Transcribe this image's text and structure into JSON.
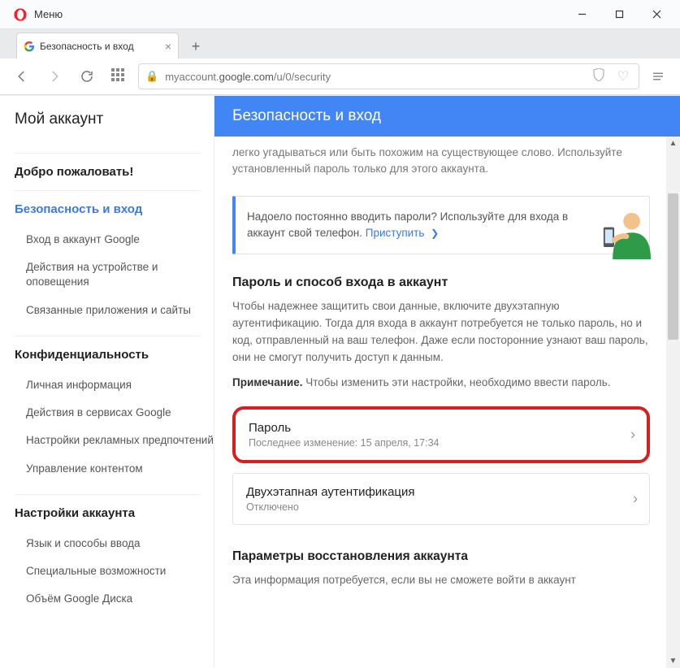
{
  "window": {
    "menu_label": "Меню"
  },
  "tab": {
    "title": "Безопасность и вход"
  },
  "url": {
    "prefix": "myaccount.",
    "domain": "google.com",
    "path": "/u/0/security"
  },
  "sidebar": {
    "title": "Мой аккаунт",
    "welcome": "Добро пожаловать!",
    "sec_h": "Безопасность и вход",
    "sec_items": {
      "a": "Вход в аккаунт Google",
      "b": "Действия на устройстве и оповещения",
      "c": "Связанные приложения и сайты"
    },
    "priv_h": "Конфиденциальность",
    "priv_items": {
      "a": "Личная информация",
      "b": "Действия в сервисах Google",
      "c": "Настройки рекламных предпочтений",
      "d": "Управление контентом"
    },
    "acct_h": "Настройки аккаунта",
    "acct_items": {
      "a": "Язык и способы ввода",
      "b": "Специальные возможности",
      "c": "Объём Google Диска"
    }
  },
  "main": {
    "header": "Безопасность и вход",
    "intro": "легко угадываться или быть похожим на существующее слово. Используйте установленный пароль только для этого аккаунта.",
    "phone_banner_text": "Надоело постоянно вводить пароли? Используйте для входа в аккаунт свой телефон. ",
    "phone_banner_link": "Приступить",
    "signin_h": "Пароль и способ входа в аккаунт",
    "signin_p1": "Чтобы надежнее защитить свои данные, включите двухэтапную аутентификацию. Тогда для входа в аккаунт потребуется не только пароль, но и код, отправленный на ваш телефон. Даже если посторонние узнают ваш пароль, они не смогут получить доступ к данным.",
    "signin_note_label": "Примечание.",
    "signin_note": " Чтобы изменить эти настройки, необходимо ввести пароль.",
    "password_row": {
      "title": "Пароль",
      "sub": "Последнее изменение: 15 апреля, 17:34"
    },
    "twostep_row": {
      "title": "Двухэтапная аутентификация",
      "sub": "Отключено"
    },
    "recovery_h": "Параметры восстановления аккаунта",
    "recovery_p": "Эта информация потребуется, если вы не сможете войти в аккаунт"
  }
}
